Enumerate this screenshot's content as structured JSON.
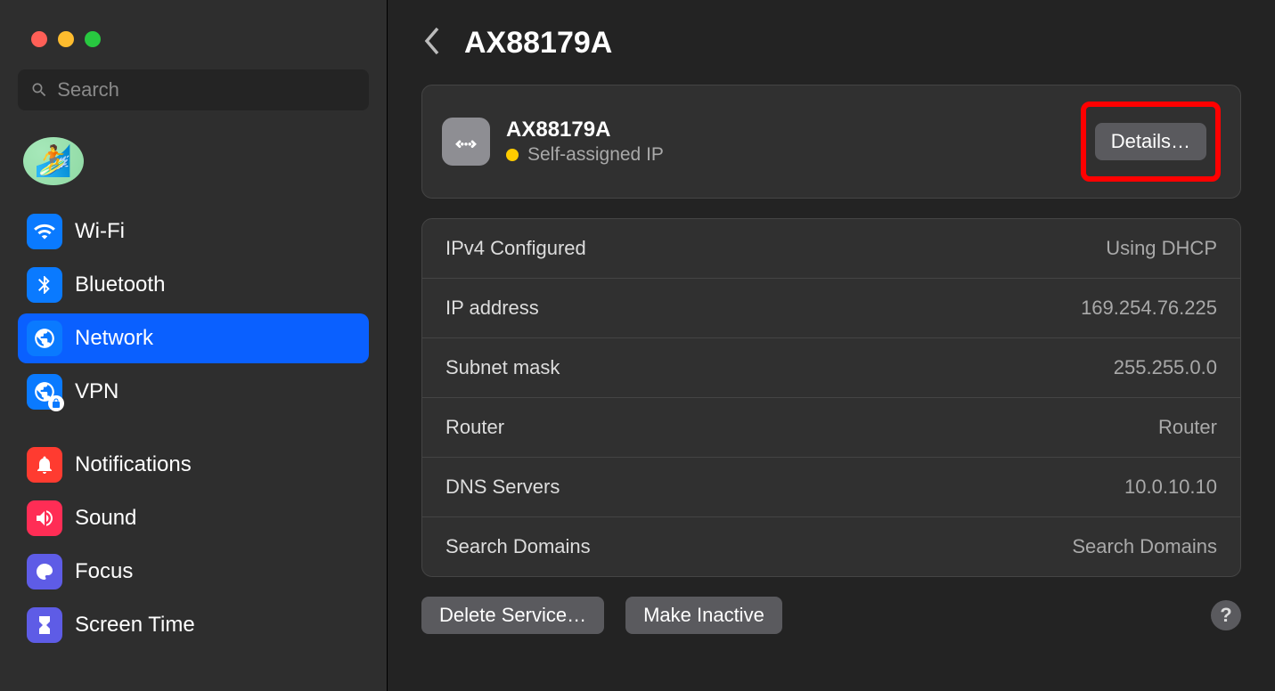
{
  "search": {
    "placeholder": "Search"
  },
  "sidebar": {
    "items": [
      {
        "label": "Wi-Fi"
      },
      {
        "label": "Bluetooth"
      },
      {
        "label": "Network"
      },
      {
        "label": "VPN"
      },
      {
        "label": "Notifications"
      },
      {
        "label": "Sound"
      },
      {
        "label": "Focus"
      },
      {
        "label": "Screen Time"
      }
    ]
  },
  "header": {
    "title": "AX88179A"
  },
  "interface": {
    "name": "AX88179A",
    "status": "Self-assigned IP",
    "status_color": "#ffcc00",
    "details_button": "Details…"
  },
  "details": [
    {
      "label": "IPv4 Configured",
      "value": "Using DHCP"
    },
    {
      "label": "IP address",
      "value": "169.254.76.225"
    },
    {
      "label": "Subnet mask",
      "value": "255.255.0.0"
    },
    {
      "label": "Router",
      "value": "Router"
    },
    {
      "label": "DNS Servers",
      "value": "10.0.10.10"
    },
    {
      "label": "Search Domains",
      "value": "Search Domains"
    }
  ],
  "actions": {
    "delete": "Delete Service…",
    "make_inactive": "Make Inactive",
    "help": "?"
  },
  "highlight": {
    "target": "details-button",
    "color": "#ff0000"
  }
}
